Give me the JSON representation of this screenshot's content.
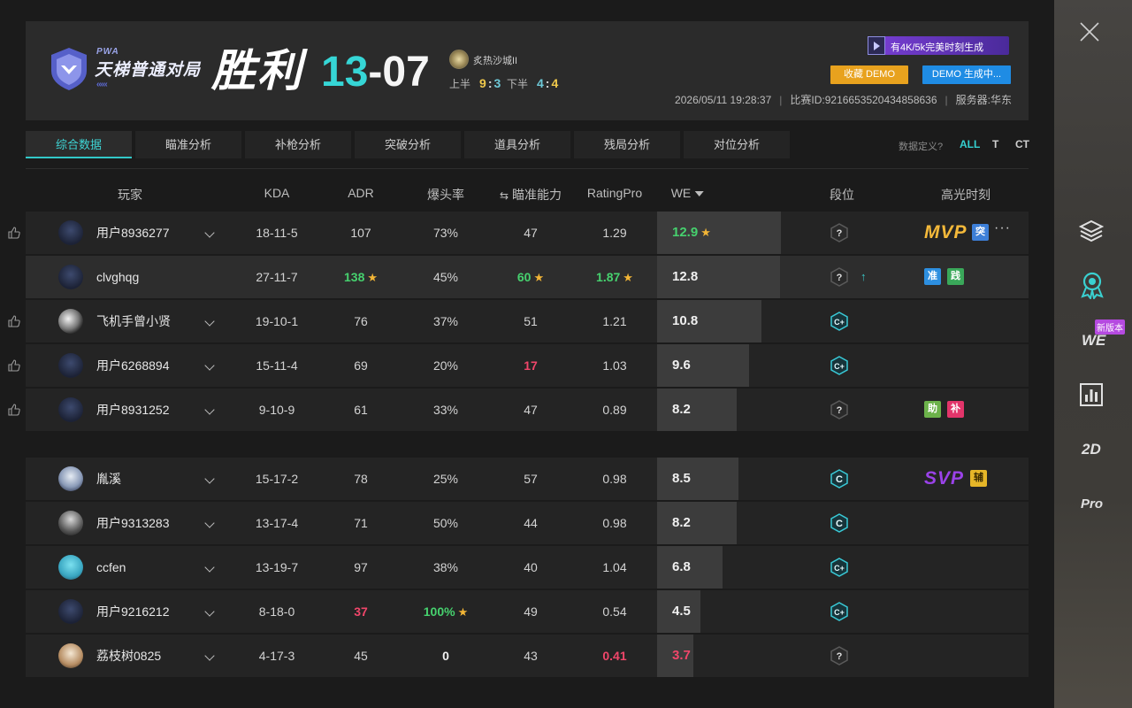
{
  "header": {
    "logo_pwa": "PWA",
    "logo_title": "天梯普通对局",
    "logo_chevrons": "‹‹‹‹‹",
    "result": "胜利",
    "score_own": "13",
    "score_sep": "-",
    "score_opp": "07",
    "map_name": "炙热沙城II",
    "first_half_label": "上半",
    "first_half_own": "9",
    "first_half_opp": "3",
    "second_half_label": "下半",
    "second_half_own": "4",
    "second_half_opp": "4",
    "promo_text": "有4K/5k完美时刻生成",
    "save_demo_label": "收藏 DEMO",
    "demo_gen_label": "DEMO 生成中...",
    "datetime": "2026/05/11 19:28:37",
    "match_id": "比赛ID:9216653520434858636",
    "server": "服务器:华东"
  },
  "tabs": [
    "综合数据",
    "瞄准分析",
    "补枪分析",
    "突破分析",
    "道具分析",
    "残局分析",
    "对位分析"
  ],
  "filters": {
    "data_def": "数据定义?",
    "all": "ALL",
    "t": "T",
    "ct": "CT"
  },
  "columns": {
    "player": "玩家",
    "kda": "KDA",
    "adr": "ADR",
    "hs": "爆头率",
    "aim": "瞄准能力",
    "rating": "RatingPro",
    "we": "WE",
    "rank": "段位",
    "highlights": "高光时刻"
  },
  "team1": [
    {
      "name": "用户8936277",
      "kda": "18-11-5",
      "adr": "107",
      "hs": "73%",
      "aim": "47",
      "rating": "1.29",
      "we": "12.9",
      "we_frac": 1.0,
      "rank": "?",
      "like": true
    },
    {
      "name": "clvghqg",
      "kda": "27-11-7",
      "adr": "138",
      "hs": "45%",
      "aim": "60",
      "rating": "1.87",
      "we": "12.8",
      "we_frac": 0.99,
      "rank": "?",
      "like": false
    },
    {
      "name": "飞机手曾小贤",
      "kda": "19-10-1",
      "adr": "76",
      "hs": "37%",
      "aim": "51",
      "rating": "1.21",
      "we": "10.8",
      "we_frac": 0.84,
      "rank": "C+",
      "like": true
    },
    {
      "name": "用户6268894",
      "kda": "15-11-4",
      "adr": "69",
      "hs": "20%",
      "aim": "17",
      "rating": "1.03",
      "we": "9.6",
      "we_frac": 0.74,
      "rank": "C+",
      "like": true
    },
    {
      "name": "用户8931252",
      "kda": "9-10-9",
      "adr": "61",
      "hs": "33%",
      "aim": "47",
      "rating": "0.89",
      "we": "8.2",
      "we_frac": 0.64,
      "rank": "?",
      "like": true
    }
  ],
  "team2": [
    {
      "name": "胤溪",
      "kda": "15-17-2",
      "adr": "78",
      "hs": "25%",
      "aim": "57",
      "rating": "0.98",
      "we": "8.5",
      "we_frac": 0.66,
      "rank": "C"
    },
    {
      "name": "用户9313283",
      "kda": "13-17-4",
      "adr": "71",
      "hs": "50%",
      "aim": "44",
      "rating": "0.98",
      "we": "8.2",
      "we_frac": 0.64,
      "rank": "C"
    },
    {
      "name": "ccfen",
      "kda": "13-19-7",
      "adr": "97",
      "hs": "38%",
      "aim": "40",
      "rating": "1.04",
      "we": "6.8",
      "we_frac": 0.53,
      "rank": "C+"
    },
    {
      "name": "用户9216212",
      "kda": "8-18-0",
      "adr": "37",
      "hs": "100%",
      "aim": "49",
      "rating": "0.54",
      "we": "4.5",
      "we_frac": 0.35,
      "rank": "C+"
    },
    {
      "name": "荔枝树0825",
      "kda": "4-17-3",
      "adr": "45",
      "hs": "0",
      "aim": "43",
      "rating": "0.41",
      "we": "3.7",
      "we_frac": 0.29,
      "rank": "?"
    }
  ],
  "highlights": {
    "mvp": "MVP",
    "svp": "SVP",
    "tag_tu": "突",
    "tag_zhun": "准",
    "tag_jian": "践",
    "tag_zhu": "助",
    "tag_bu": "补",
    "tag_pu": "辅",
    "more": "···",
    "rank_up": "↑"
  },
  "right_panel": {
    "we": "WE",
    "new_version": "新版本",
    "two_d": "2D",
    "pro": "Pro"
  },
  "colors": {
    "accent": "#36d6d6",
    "green": "#46d16e",
    "red": "#f0466a",
    "gold": "#f4b93a",
    "purple": "#9a42e8"
  }
}
